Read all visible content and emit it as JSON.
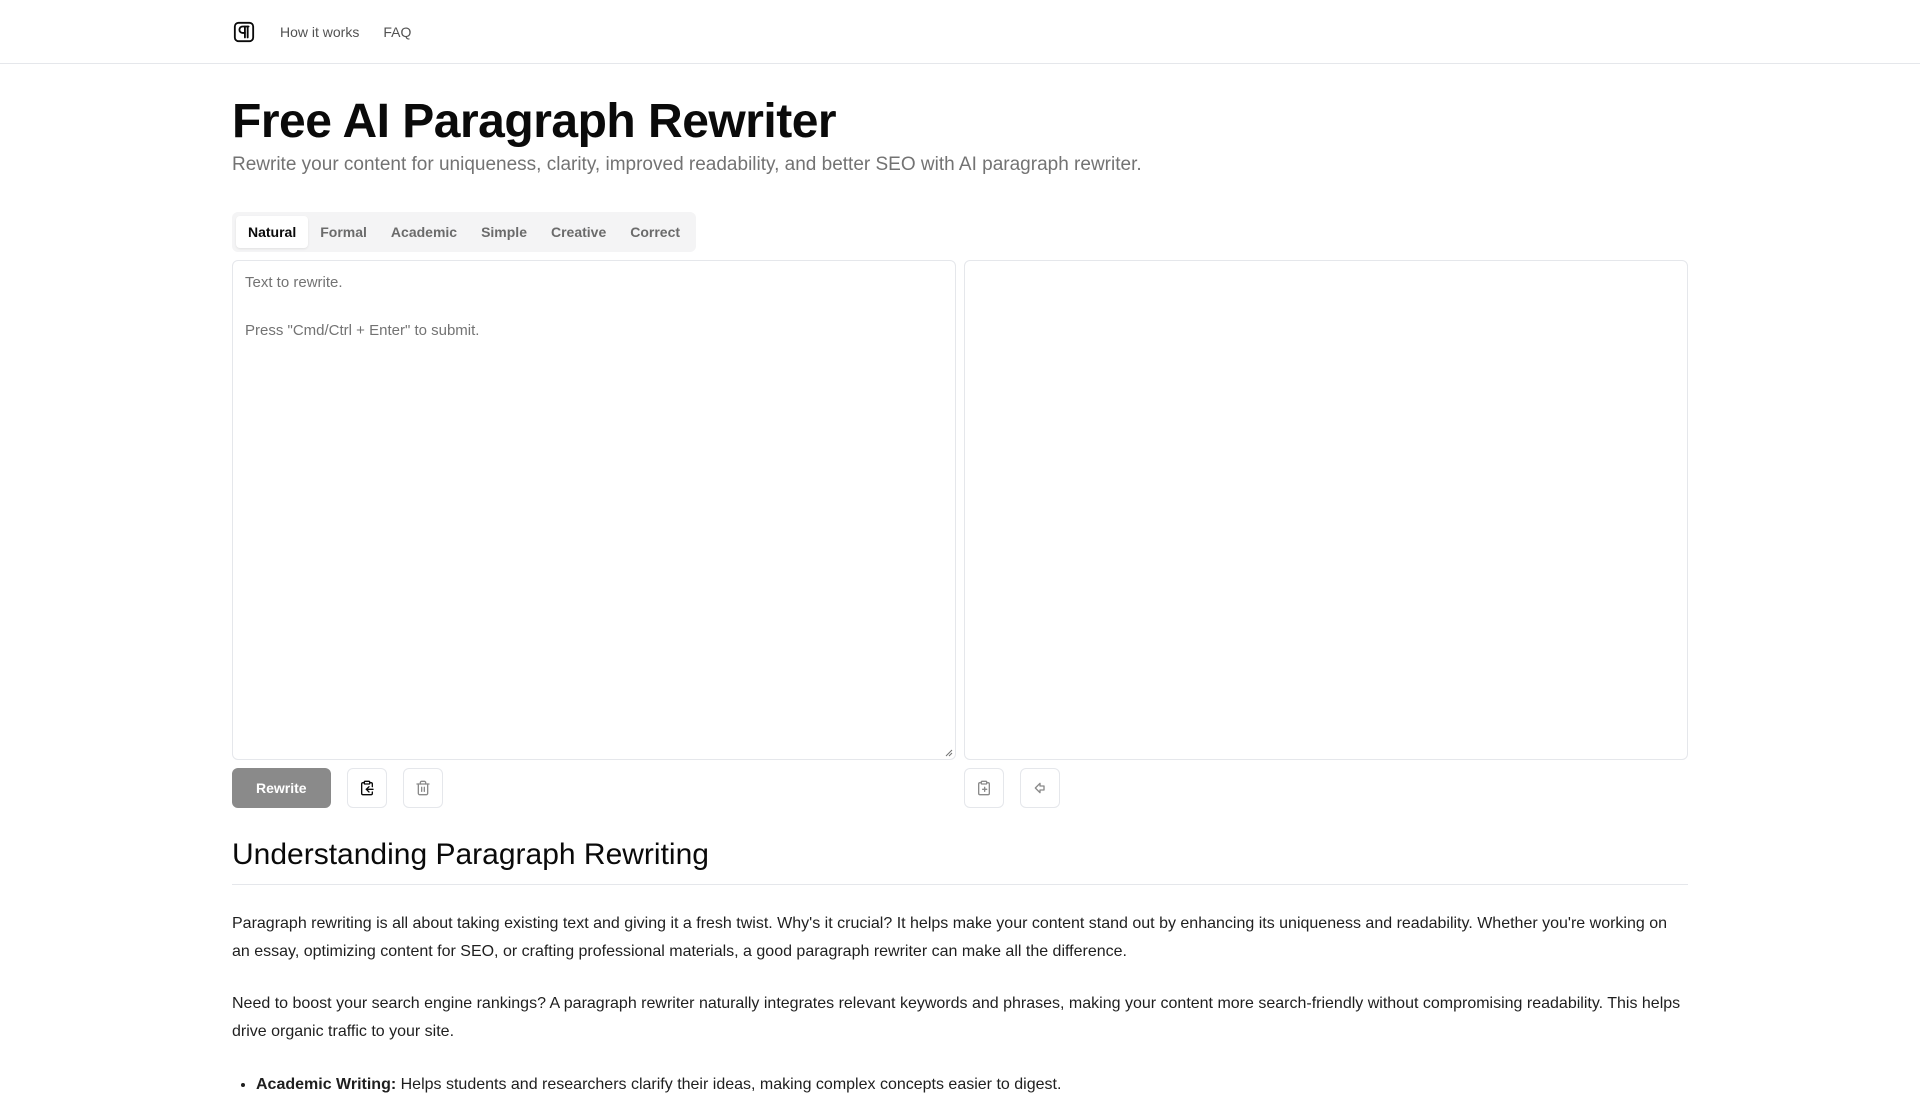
{
  "header": {
    "logo_icon": "pilcrow-icon",
    "nav": [
      {
        "label": "How it works"
      },
      {
        "label": "FAQ"
      }
    ]
  },
  "hero": {
    "title": "Free AI Paragraph Rewriter",
    "subtitle": "Rewrite your content for uniqueness, clarity, improved readability, and better SEO with AI paragraph rewriter."
  },
  "modes": {
    "selected": "Natural",
    "tabs": [
      {
        "label": "Natural"
      },
      {
        "label": "Formal"
      },
      {
        "label": "Academic"
      },
      {
        "label": "Simple"
      },
      {
        "label": "Creative"
      },
      {
        "label": "Correct"
      }
    ]
  },
  "input": {
    "value": "",
    "placeholder": "Text to rewrite.\n\nPress \"Cmd/Ctrl + Enter\" to submit."
  },
  "output": {
    "value": ""
  },
  "actions": {
    "rewrite_label": "Rewrite",
    "paste_icon": "clipboard-paste-icon",
    "clear_icon": "trash-icon",
    "copy_icon": "clipboard-copy-icon",
    "use_output_icon": "arrow-left-icon"
  },
  "article": {
    "heading": "Understanding Paragraph Rewriting",
    "paragraphs": [
      "Paragraph rewriting is all about taking existing text and giving it a fresh twist. Why's it crucial? It helps make your content stand out by enhancing its uniqueness and readability. Whether you're working on an essay, optimizing content for SEO, or crafting professional materials, a good paragraph rewriter can make all the difference.",
      "Need to boost your search engine rankings? A paragraph rewriter naturally integrates relevant keywords and phrases, making your content more search-friendly without compromising readability. This helps drive organic traffic to your site."
    ],
    "bullets": [
      {
        "term": "Academic Writing:",
        "text": " Helps students and researchers clarify their ideas, making complex concepts easier to digest."
      }
    ]
  },
  "colors": {
    "primary_button": "#8a8a8a",
    "border": "#e5e7eb",
    "muted_text": "#737373",
    "tab_bg": "#f4f4f5"
  }
}
